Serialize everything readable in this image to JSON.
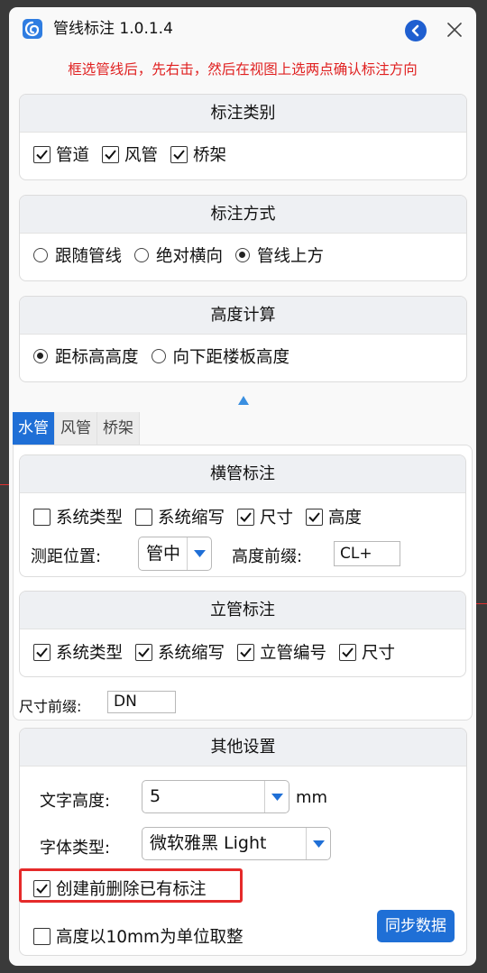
{
  "window": {
    "title": "管线标注 1.0.1.4"
  },
  "hint": "框选管线后，先右击，然后在视图上选两点确认标注方向",
  "category": {
    "header": "标注类别",
    "items": [
      {
        "label": "管道",
        "checked": true
      },
      {
        "label": "风管",
        "checked": true
      },
      {
        "label": "桥架",
        "checked": true
      }
    ]
  },
  "mode": {
    "header": "标注方式",
    "options": [
      {
        "label": "跟随管线",
        "selected": false
      },
      {
        "label": "绝对横向",
        "selected": false
      },
      {
        "label": "管线上方",
        "selected": true
      }
    ]
  },
  "height_calc": {
    "header": "高度计算",
    "options": [
      {
        "label": "距标高高度",
        "selected": true
      },
      {
        "label": "向下距楼板高度",
        "selected": false
      }
    ]
  },
  "tabs": [
    {
      "label": "水管",
      "active": true
    },
    {
      "label": "风管",
      "active": false
    },
    {
      "label": "桥架",
      "active": false
    }
  ],
  "horizontal": {
    "header": "横管标注",
    "items": [
      {
        "label": "系统类型",
        "checked": false
      },
      {
        "label": "系统缩写",
        "checked": false
      },
      {
        "label": "尺寸",
        "checked": true
      },
      {
        "label": "高度",
        "checked": true
      }
    ],
    "distance_label": "测距位置:",
    "distance_value": "管中",
    "prefix_label": "高度前缀:",
    "prefix_value": "CL+"
  },
  "vertical": {
    "header": "立管标注",
    "items": [
      {
        "label": "系统类型",
        "checked": true
      },
      {
        "label": "系统缩写",
        "checked": true
      },
      {
        "label": "立管编号",
        "checked": true
      },
      {
        "label": "尺寸",
        "checked": true
      }
    ]
  },
  "size_prefix": {
    "label": "尺寸前缀:",
    "value": "DN"
  },
  "other": {
    "header": "其他设置",
    "text_height_label": "文字高度:",
    "text_height_value": "5",
    "text_height_unit": "mm",
    "font_label": "字体类型:",
    "font_value": "微软雅黑 Light",
    "delete_existing": {
      "label": "创建前删除已有标注",
      "checked": true
    },
    "round_height": {
      "label": "高度以10mm为单位取整",
      "checked": false
    },
    "sync_button": "同步数据"
  },
  "colors": {
    "accent": "#1f6fd6",
    "hint_red": "#e02020",
    "highlight_red": "#e52a2a"
  },
  "icons": [
    "app-logo-icon",
    "collapse-left-icon",
    "close-icon",
    "check-icon",
    "chevron-up-icon",
    "dropdown-arrow-icon"
  ]
}
